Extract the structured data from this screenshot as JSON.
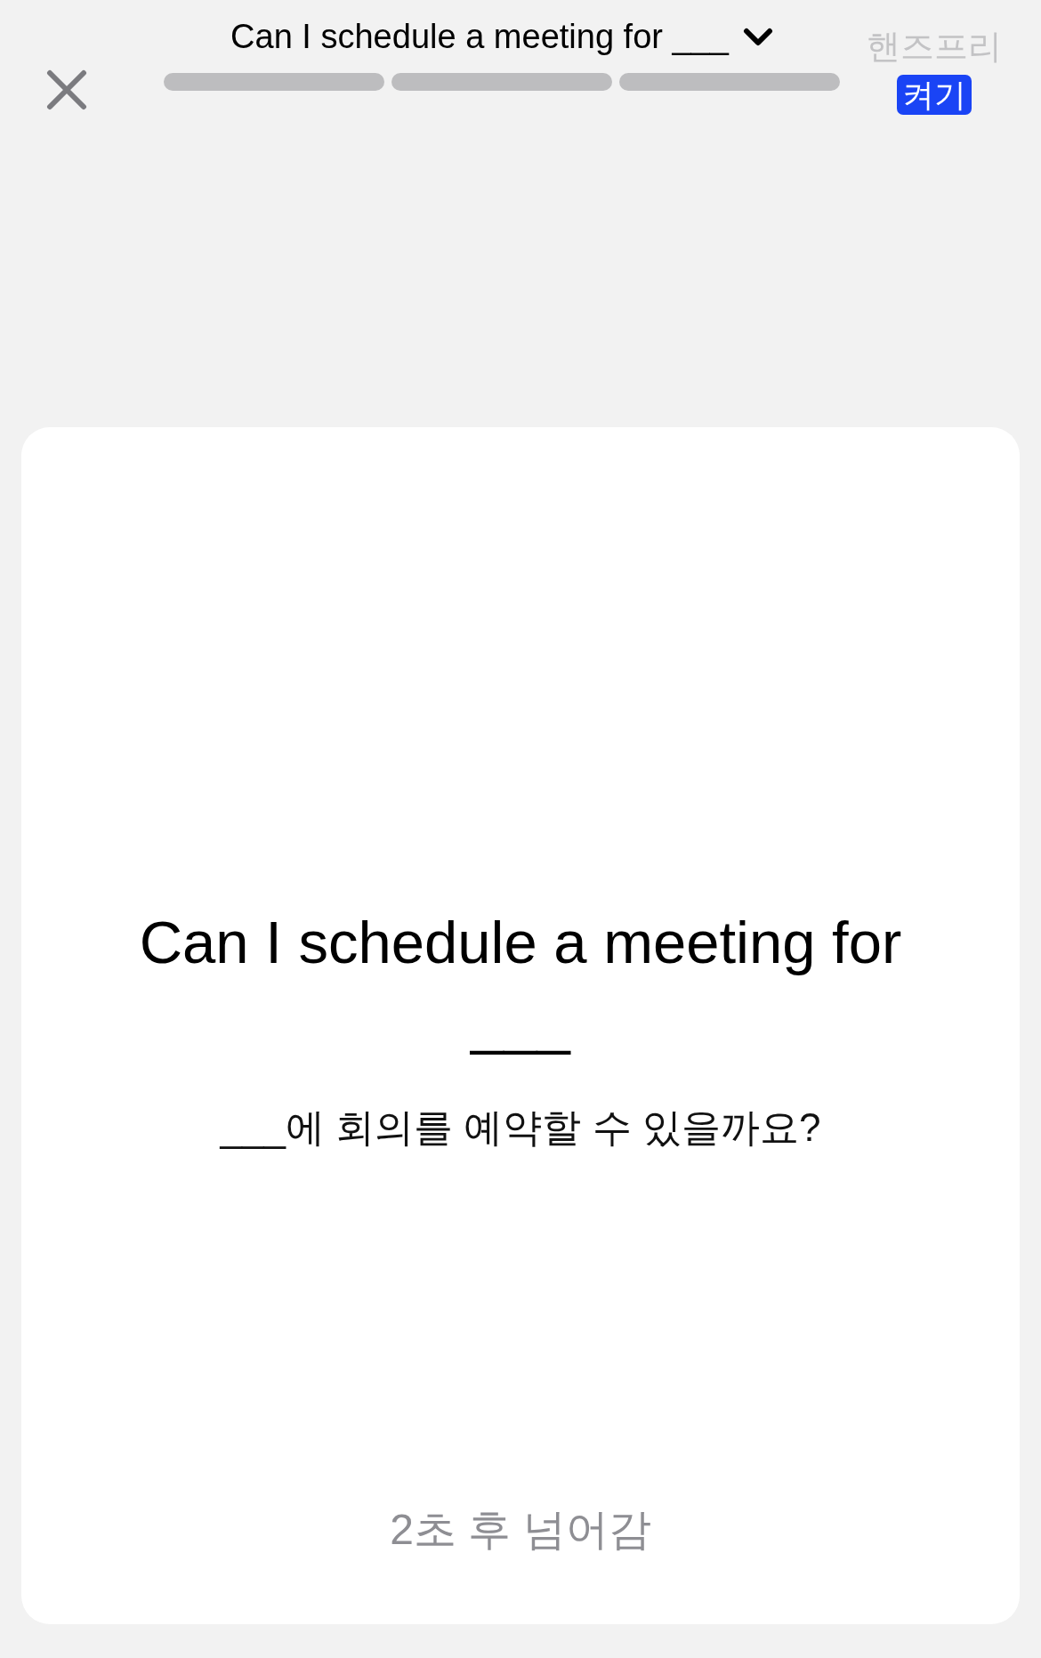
{
  "header": {
    "title": "Can I schedule a meeting for ___",
    "progress": [
      {
        "level": 0
      },
      {
        "level": 0
      },
      {
        "level": 0
      }
    ],
    "handsfree": {
      "label": "핸즈프리",
      "button": "켜기"
    }
  },
  "card": {
    "sentence": "Can I schedule a meeting for ___",
    "translation": "___에 회의를 예약할 수 있을까요?",
    "footer": "2초 후 넘어감"
  }
}
